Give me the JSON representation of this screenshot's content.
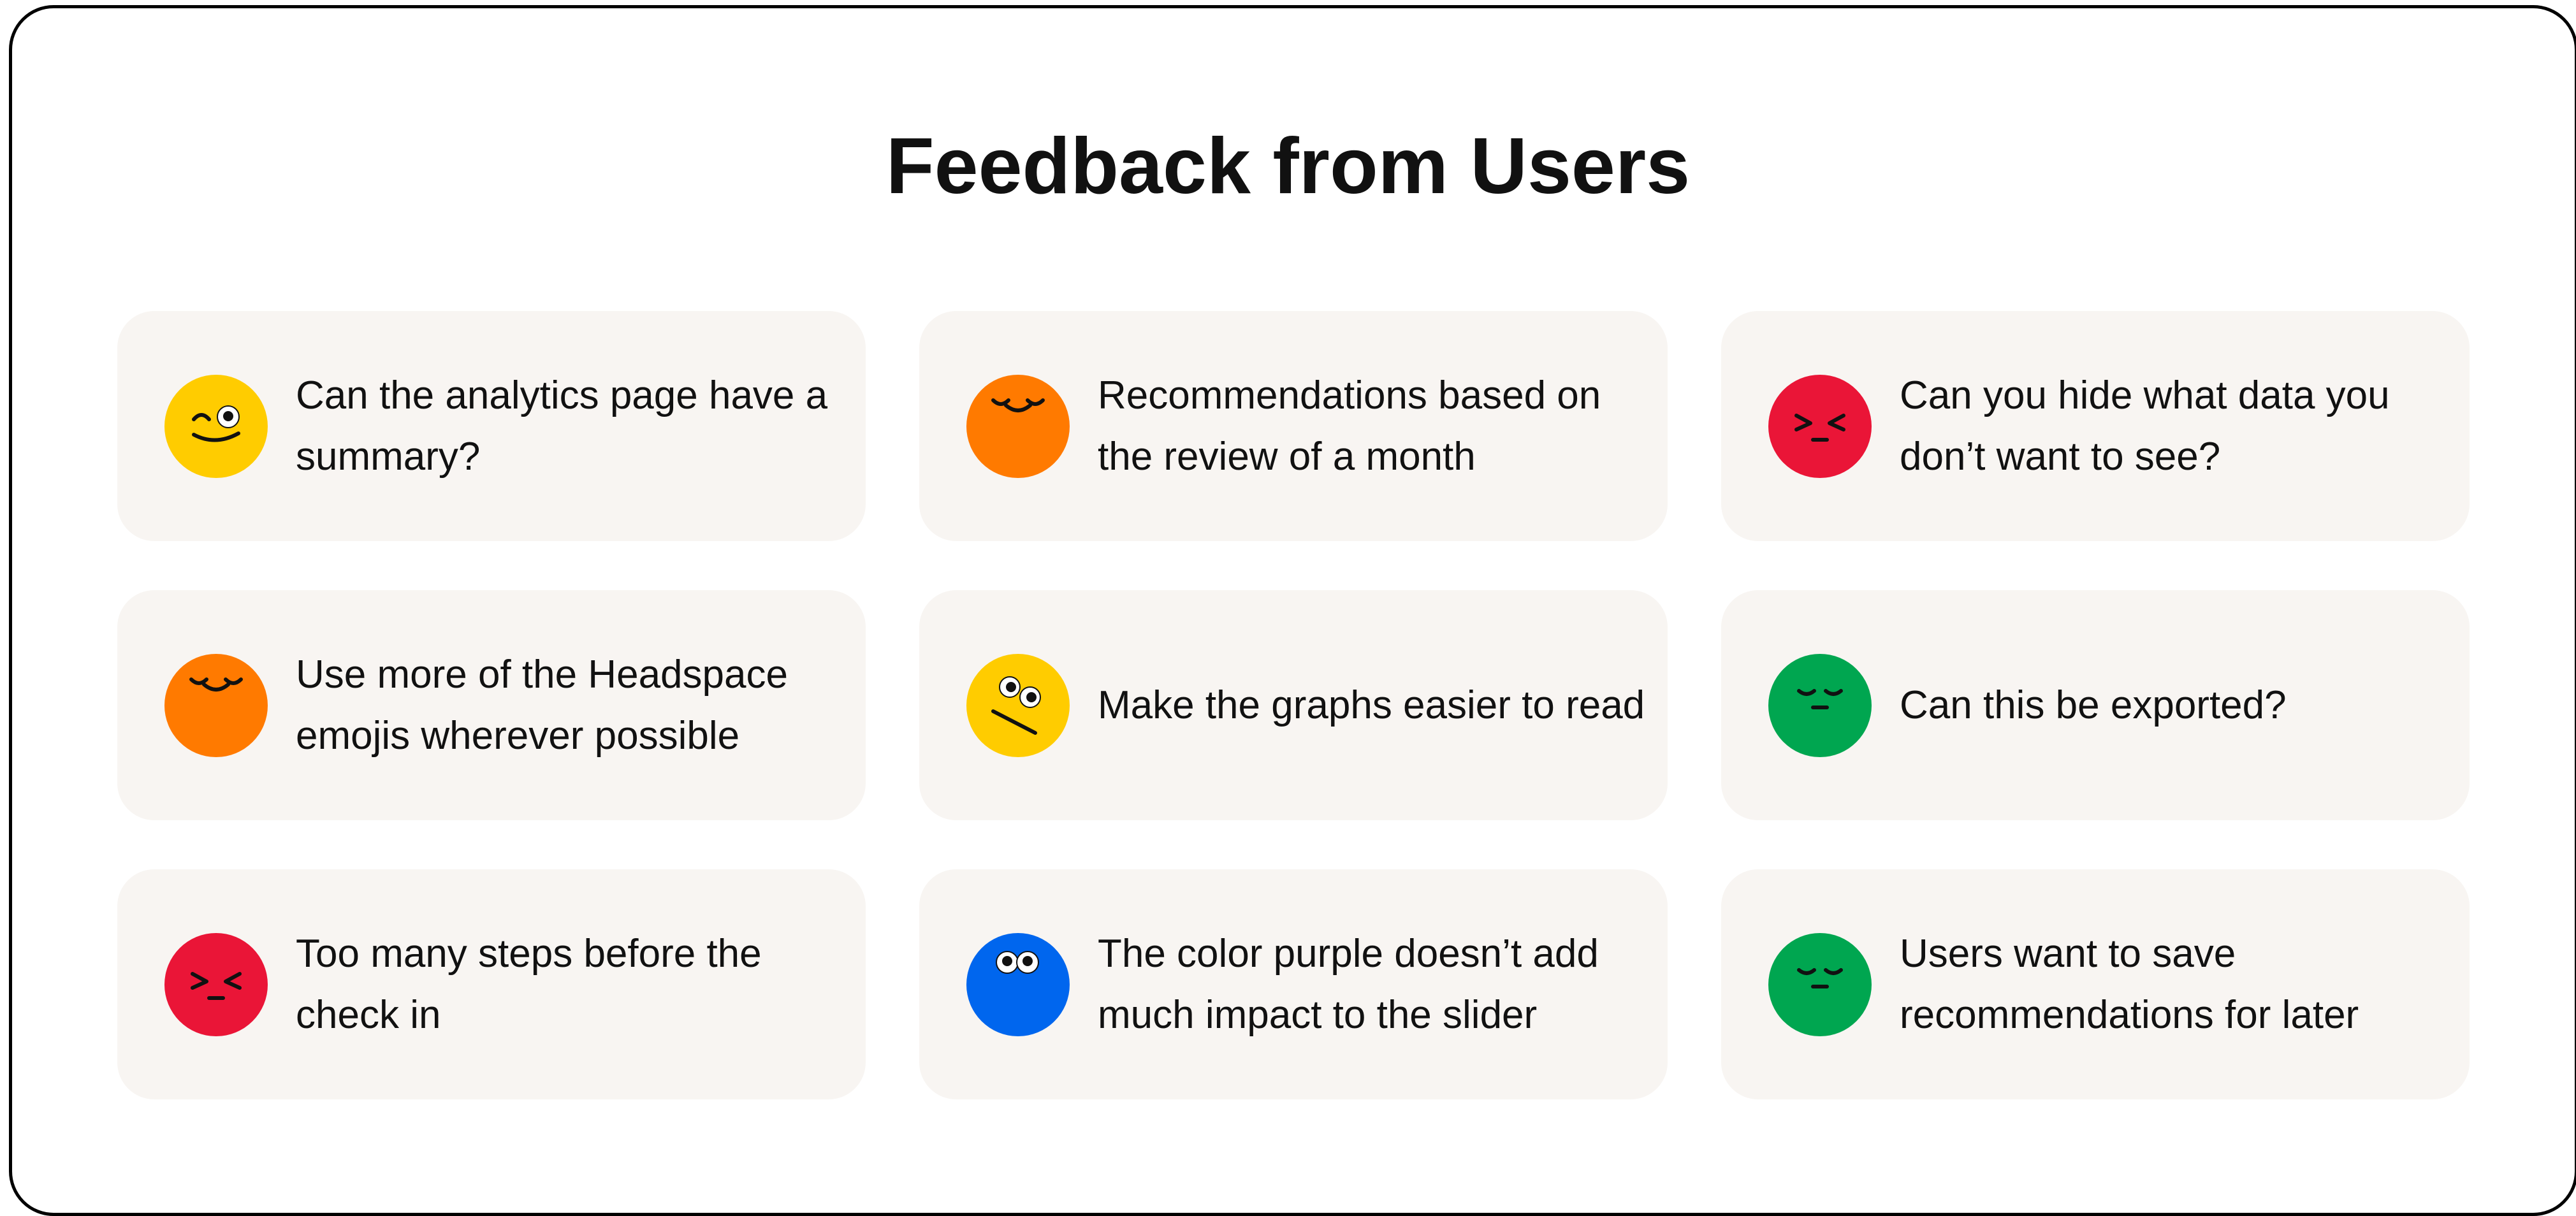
{
  "title": "Feedback from Users",
  "colors": {
    "frame_border": "#000000",
    "card_background": "#f8f5f2",
    "text": "#111111",
    "yellow": "#ffcc00",
    "orange": "#ff7a00",
    "red": "#ea1537",
    "green": "#00a650",
    "blue": "#0066ee"
  },
  "cards": [
    {
      "text": "Can the analytics page have a summary?",
      "emoji": "wink-smile-icon",
      "color": "#ffcc00"
    },
    {
      "text": "Recommendations based on the review of a month",
      "emoji": "content-closed-eyes-icon",
      "color": "#ff7a00"
    },
    {
      "text": "Can you hide what data you don’t want to see?",
      "emoji": "squint-frown-icon",
      "color": "#ea1537"
    },
    {
      "text": "Use more of the Headspace emojis wherever possible",
      "emoji": "content-closed-eyes-icon",
      "color": "#ff7a00"
    },
    {
      "text": "Make the graphs easier to read",
      "emoji": "confused-eyes-icon",
      "color": "#ffcc00"
    },
    {
      "text": "Can this be exported?",
      "emoji": "calm-closed-eyes-icon",
      "color": "#00a650"
    },
    {
      "text": "Too many steps before the check in",
      "emoji": "squint-frown-icon",
      "color": "#ea1537"
    },
    {
      "text": "The color purple doesn’t add much impact to the slider",
      "emoji": "wide-eyes-icon",
      "color": "#0066ee"
    },
    {
      "text": "Users want to save recommendations for later",
      "emoji": "calm-closed-eyes-icon",
      "color": "#00a650"
    }
  ]
}
